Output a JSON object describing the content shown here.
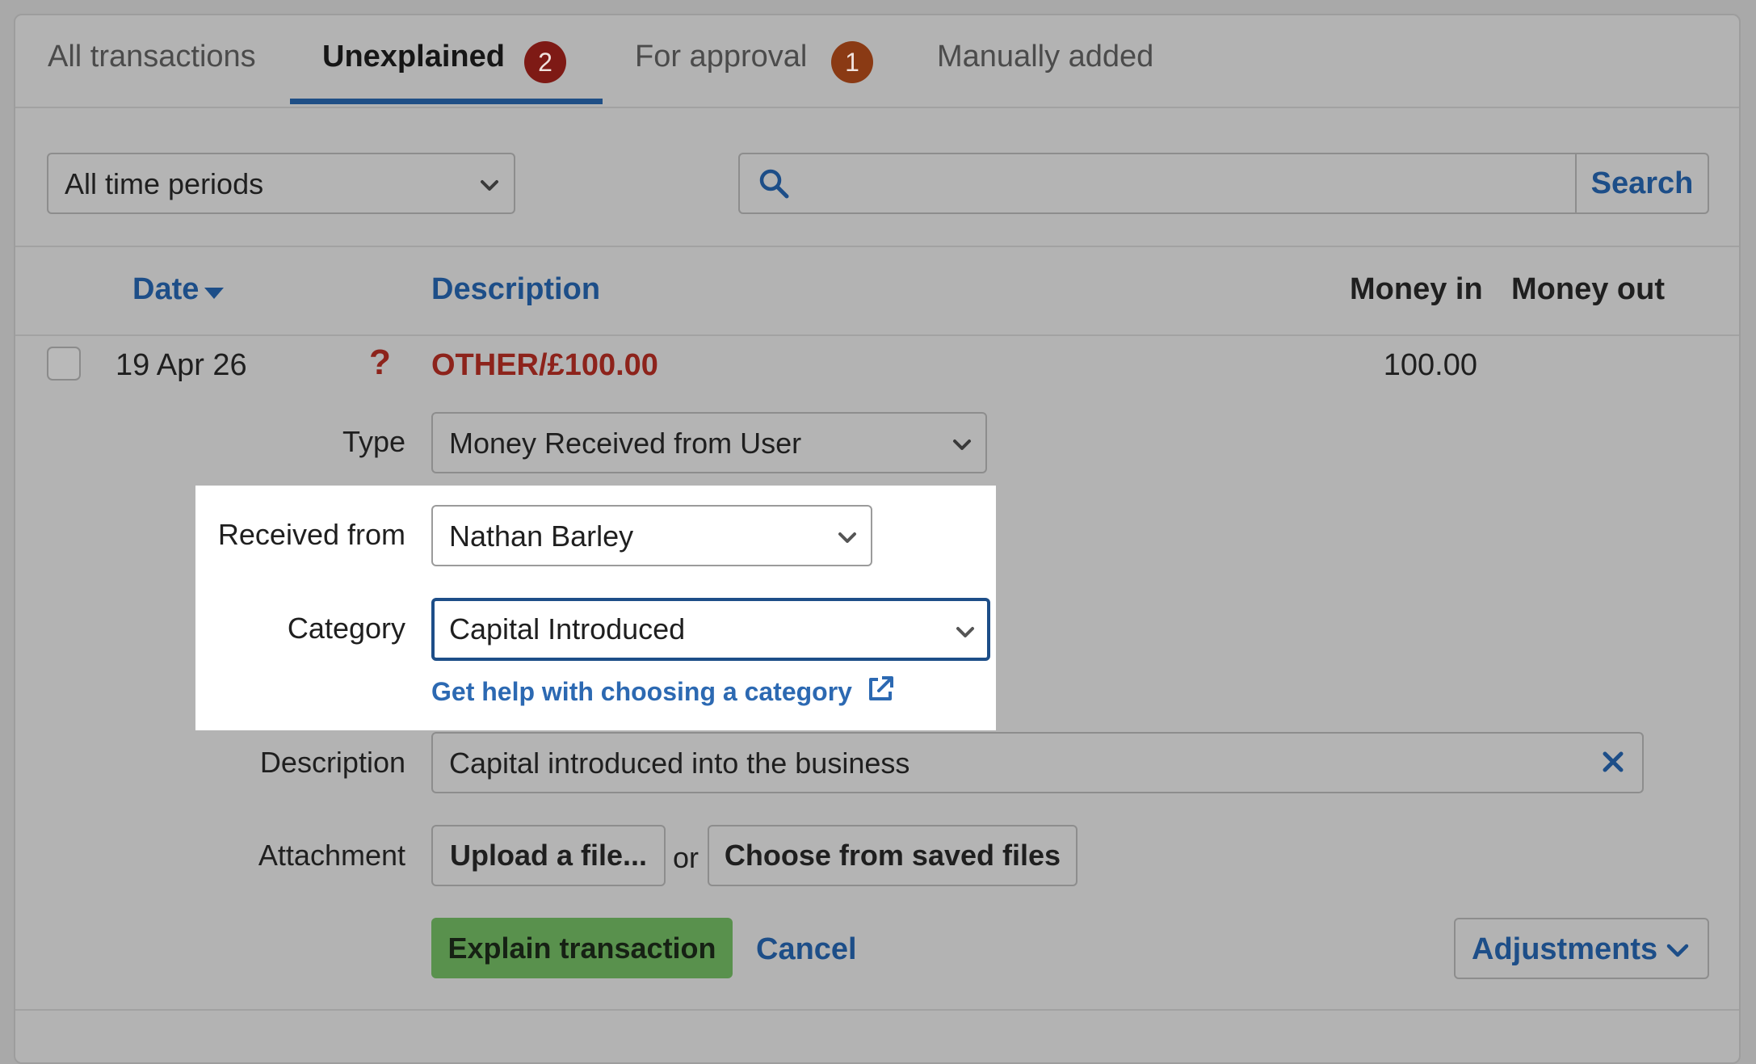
{
  "tabs": [
    {
      "label": "All transactions"
    },
    {
      "label": "Unexplained",
      "badge": "2"
    },
    {
      "label": "For approval",
      "badge": "1"
    },
    {
      "label": "Manually added"
    }
  ],
  "filters": {
    "period_value": "All time periods",
    "search_value": "",
    "search_button": "Search"
  },
  "table": {
    "headers": {
      "date": "Date",
      "description": "Description",
      "money_in": "Money in",
      "money_out": "Money out"
    },
    "row": {
      "date": "19 Apr 26",
      "status_glyph": "?",
      "description": "OTHER/£100.00",
      "money_in": "100.00",
      "money_out": ""
    }
  },
  "form": {
    "type_label": "Type",
    "type_value": "Money Received from User",
    "received_from_label": "Received from",
    "received_from_value": "Nathan Barley",
    "category_label": "Category",
    "category_value": "Capital Introduced",
    "help_link": "Get help with choosing a category",
    "description_label": "Description",
    "description_value": "Capital introduced into the business",
    "attachment_label": "Attachment",
    "upload_button": "Upload a file...",
    "or_text": "or",
    "saved_files_button": "Choose from saved files",
    "explain_button": "Explain transaction",
    "cancel_link": "Cancel",
    "adjustments_button": "Adjustments"
  },
  "colors": {
    "link_blue": "#1d4e88",
    "focus_blue": "#1d4e88",
    "unexplained_red": "#8d231b",
    "explain_green": "#59914d"
  }
}
